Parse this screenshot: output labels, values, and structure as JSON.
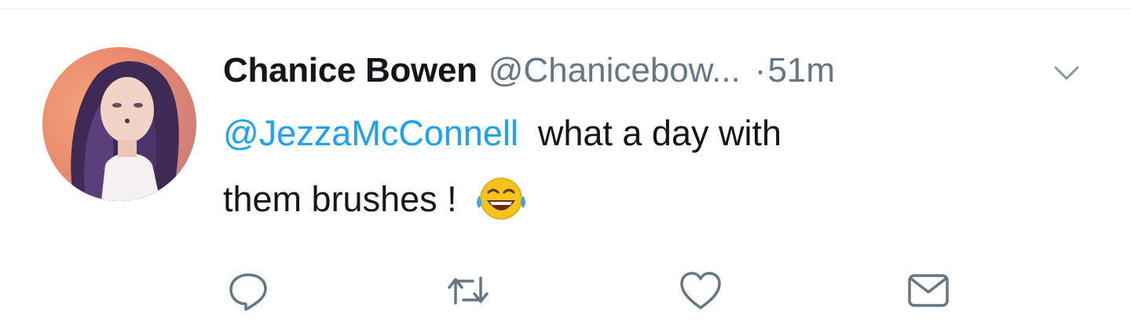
{
  "tweet": {
    "author_name": "Chanice Bowen",
    "author_handle": "@Chanicebow...",
    "separator": "·",
    "timestamp": "51m",
    "mention": "@JezzaMcConnell",
    "text_line1": "what a day with",
    "text_line2": "them brushes !",
    "emoji": "face-with-tears-of-joy"
  },
  "actions": [
    "reply-icon",
    "retweet-icon",
    "like-icon",
    "direct-message-icon"
  ],
  "colors": {
    "name": "#14171a",
    "meta": "#657786",
    "mention": "#1da1f2",
    "icons": "#657786"
  }
}
